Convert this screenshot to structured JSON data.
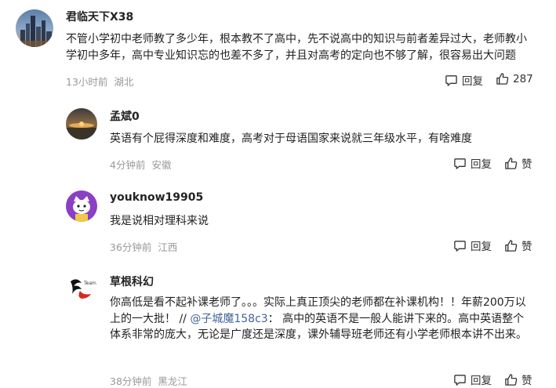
{
  "comments": [
    {
      "username": "君临天下X38",
      "text": "不管小学初中老师教了多少年，根本教不了高中，先不说高中的知识与前者差异过大，老师教小学初中多年，高中专业知识忘的也差不多了，并且对高考的定向也不够了解，很容易出大问题",
      "time": "13小时前",
      "location": "湖北",
      "reply_label": "回复",
      "like_label": "287",
      "avatar": "city-skyline"
    },
    {
      "username": "孟斌0",
      "text": "英语有个屁得深度和难度，高考对于母语国家来说就三年级水平，有啥难度",
      "time": "4分钟前",
      "location": "安徽",
      "reply_label": "回复",
      "like_label": "赞",
      "avatar": "sunset"
    },
    {
      "username": "youknow19905",
      "text": "我是说相对理科来说",
      "time": "36分钟前",
      "location": "江西",
      "reply_label": "回复",
      "like_label": "赞",
      "avatar": "cartoon-cat"
    },
    {
      "username": "草根科幻",
      "text_before": "你高低是看不起补课老师了。。。实际上真正顶尖的老师都在补课机构！！年薪200万以上的一大批！ // ",
      "mention": "@子城魔158c3",
      "text_after": "： 高中的英语不是一般人能讲下来的。高中英语整个体系非常的庞大，无论是广度还是深度，课外辅导班老师还有小学老师根本讲不出来。",
      "time": "38分钟前",
      "location": "黑龙江",
      "reply_label": "回复",
      "like_label": "赞",
      "avatar": "team-logo",
      "avatar_text": "Team"
    }
  ],
  "colors": {
    "meta": "#999999",
    "mention": "#406599",
    "text": "#222222"
  },
  "icons": {
    "reply": "comment-bubble-icon",
    "like": "thumbs-up-icon"
  }
}
